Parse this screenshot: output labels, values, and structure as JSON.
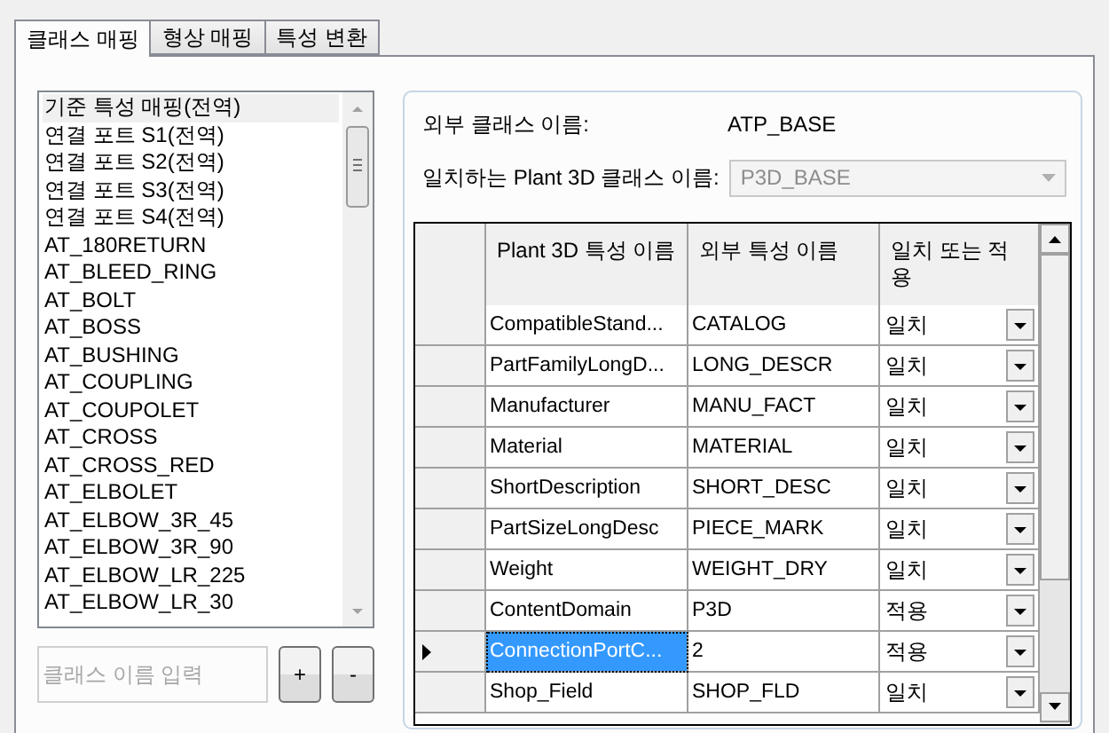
{
  "tabs": [
    {
      "label": "클래스 매핑",
      "selected": true
    },
    {
      "label": "형상 매핑",
      "selected": false
    },
    {
      "label": "특성 변환",
      "selected": false
    }
  ],
  "class_list": {
    "items": [
      {
        "label": "기준 특성 매핑(전역)",
        "selected": true
      },
      {
        "label": "연결 포트 S1(전역)",
        "selected": false
      },
      {
        "label": "연결 포트 S2(전역)",
        "selected": false
      },
      {
        "label": "연결 포트 S3(전역)",
        "selected": false
      },
      {
        "label": "연결 포트 S4(전역)",
        "selected": false
      },
      {
        "label": "AT_180RETURN",
        "selected": false
      },
      {
        "label": "AT_BLEED_RING",
        "selected": false
      },
      {
        "label": "AT_BOLT",
        "selected": false
      },
      {
        "label": "AT_BOSS",
        "selected": false
      },
      {
        "label": "AT_BUSHING",
        "selected": false
      },
      {
        "label": "AT_COUPLING",
        "selected": false
      },
      {
        "label": "AT_COUPOLET",
        "selected": false
      },
      {
        "label": "AT_CROSS",
        "selected": false
      },
      {
        "label": "AT_CROSS_RED",
        "selected": false
      },
      {
        "label": "AT_ELBOLET",
        "selected": false
      },
      {
        "label": "AT_ELBOW_3R_45",
        "selected": false
      },
      {
        "label": "AT_ELBOW_3R_90",
        "selected": false
      },
      {
        "label": "AT_ELBOW_LR_225",
        "selected": false
      },
      {
        "label": "AT_ELBOW_LR_30",
        "selected": false
      }
    ]
  },
  "class_name_input": {
    "placeholder": "클래스 이름 입력"
  },
  "buttons": [
    "+",
    "-"
  ],
  "external_class": {
    "label": "외부 클래스 이름:",
    "value": "ATP_BASE"
  },
  "plant3d_class": {
    "label": "일치하는 Plant 3D 클래스 이름:",
    "value": "P3D_BASE",
    "disabled": true
  },
  "grid": {
    "columns": [
      "Plant 3D 특성 이름",
      "외부 특성 이름",
      "일치 또는 적용"
    ],
    "rows": [
      {
        "plant3d": "CompatibleStand...",
        "external": "CATALOG",
        "mode": "일치",
        "selected": false
      },
      {
        "plant3d": "PartFamilyLongD...",
        "external": "LONG_DESCR",
        "mode": "일치",
        "selected": false
      },
      {
        "plant3d": "Manufacturer",
        "external": "MANU_FACT",
        "mode": "일치",
        "selected": false
      },
      {
        "plant3d": "Material",
        "external": "MATERIAL",
        "mode": "일치",
        "selected": false
      },
      {
        "plant3d": "ShortDescription",
        "external": "SHORT_DESC",
        "mode": "일치",
        "selected": false
      },
      {
        "plant3d": "PartSizeLongDesc",
        "external": "PIECE_MARK",
        "mode": "일치",
        "selected": false
      },
      {
        "plant3d": "Weight",
        "external": "WEIGHT_DRY",
        "mode": "일치",
        "selected": false
      },
      {
        "plant3d": "ContentDomain",
        "external": "P3D",
        "mode": "적용",
        "selected": false
      },
      {
        "plant3d": "ConnectionPortC...",
        "external": "2",
        "mode": "적용",
        "selected": true
      },
      {
        "plant3d": "Shop_Field",
        "external": "SHOP_FLD",
        "mode": "일치",
        "selected": false
      }
    ]
  }
}
